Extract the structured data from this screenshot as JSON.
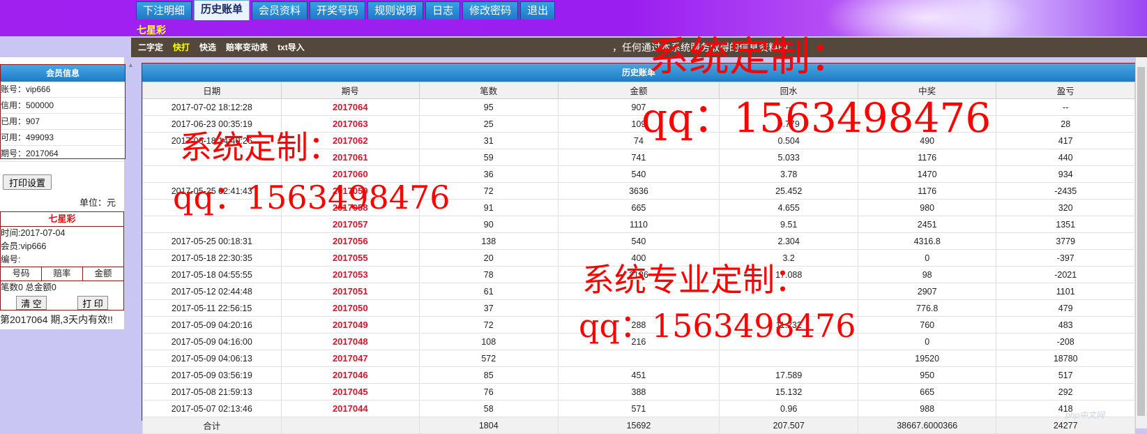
{
  "nav": {
    "tabs": [
      {
        "label": "下注明细"
      },
      {
        "label": "历史账单"
      },
      {
        "label": "会员资料"
      },
      {
        "label": "开奖号码"
      },
      {
        "label": "规则说明"
      },
      {
        "label": "日志"
      },
      {
        "label": "修改密码"
      },
      {
        "label": "退出"
      }
    ],
    "active_tab": "历史账单"
  },
  "game_name": "七星彩",
  "subbar": {
    "links": [
      "二字定",
      "快打",
      "快选",
      "赔率变动表",
      "txt导入"
    ],
    "highlighted": "快打",
    "marquee": "，任何通过本系统服务取得的信息资料的"
  },
  "member_info": {
    "title": "会员信息",
    "rows": [
      "账号：vip666",
      "信用：500000",
      "已用：907",
      "可用：499093",
      "期号：2017064"
    ]
  },
  "print_settings_label": "打印设置",
  "unit_label": "单位：元",
  "ticket": {
    "title": "七星彩",
    "time": "时间:2017-07-04",
    "member": "会员:vip666",
    "serial": "编号:",
    "cols": [
      "号码",
      "赔率",
      "金额"
    ],
    "summary": "笔数0 总金额0",
    "clear_label": "清 空",
    "print_label": "打 印"
  },
  "validity_note": "第2017064 期,3天内有效!!",
  "history": {
    "title": "历史账单",
    "headers": [
      "日期",
      "期号",
      "笔数",
      "金额",
      "回水",
      "中奖",
      "盈亏"
    ],
    "rows": [
      [
        "2017-07-02 18:12:28",
        "2017064",
        "95",
        "907",
        "--",
        "--",
        "--"
      ],
      [
        "2017-06-23 00:35:19",
        "2017063",
        "25",
        "109",
        "0.779",
        "",
        "28"
      ],
      [
        "2017-06-18 14:40:26",
        "2017062",
        "31",
        "74",
        "0.504",
        "490",
        "417"
      ],
      [
        "",
        "2017061",
        "59",
        "741",
        "5.033",
        "1176",
        "440"
      ],
      [
        "",
        "2017060",
        "36",
        "540",
        "3.78",
        "1470",
        "934"
      ],
      [
        "2017-05-25 02:41:43",
        "2017059",
        "72",
        "3636",
        "25.452",
        "1176",
        "-2435"
      ],
      [
        "",
        "2017058",
        "91",
        "665",
        "4.655",
        "980",
        "320"
      ],
      [
        "",
        "2017057",
        "90",
        "1110",
        "9.51",
        "2451",
        "1351"
      ],
      [
        "2017-05-25 00:18:31",
        "2017056",
        "138",
        "540",
        "2.304",
        "4316.8",
        "3779"
      ],
      [
        "2017-05-18 22:30:35",
        "2017055",
        "20",
        "400",
        "3.2",
        "0",
        "-397"
      ],
      [
        "2017-05-18 04:55:55",
        "2017053",
        "78",
        "2136",
        "17.088",
        "98",
        "-2021"
      ],
      [
        "2017-05-12 02:44:48",
        "2017051",
        "61",
        "",
        "",
        "2907",
        "1101"
      ],
      [
        "2017-05-11 22:56:15",
        "2017050",
        "37",
        "",
        "",
        "776.8",
        "479"
      ],
      [
        "2017-05-09 04:20:16",
        "2017049",
        "72",
        "288",
        "11.232",
        "760",
        "483"
      ],
      [
        "2017-05-09 04:16:00",
        "2017048",
        "108",
        "216",
        "",
        "0",
        "-208"
      ],
      [
        "2017-05-09 04:06:13",
        "2017047",
        "572",
        "",
        "",
        "19520",
        "18780"
      ],
      [
        "2017-05-09 03:56:19",
        "2017046",
        "85",
        "451",
        "17.589",
        "950",
        "517"
      ],
      [
        "2017-05-08 21:59:13",
        "2017045",
        "76",
        "388",
        "15.132",
        "665",
        "292"
      ],
      [
        "2017-05-07 02:13:46",
        "2017044",
        "58",
        "571",
        "0.96",
        "988",
        "418"
      ]
    ],
    "total": [
      "合计",
      "",
      "1804",
      "15692",
      "207.507",
      "38667.6000366",
      "24277"
    ]
  },
  "watermarks": [
    {
      "text": "系统定制："
    },
    {
      "text": "qq：1563498476"
    },
    {
      "text": "系统定制："
    },
    {
      "text": "qq：1563498476"
    },
    {
      "text": "系统专业定制："
    },
    {
      "text": "qq：1563498476"
    }
  ],
  "site_logo": "php中文网"
}
